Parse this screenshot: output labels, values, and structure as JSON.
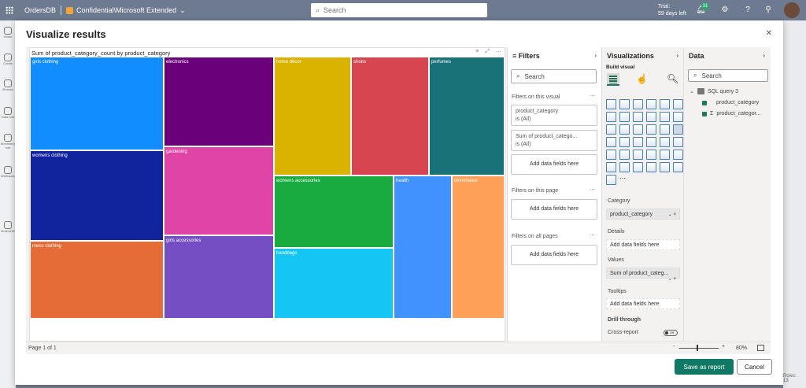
{
  "topbar": {
    "app": "OrdersDB",
    "label": "Confidential\\Microsoft Extended",
    "search_placeholder": "Search",
    "trial_line1": "Trial:",
    "trial_line2": "59 days left",
    "notifications": "31"
  },
  "leftnav": [
    "Home",
    "Create",
    "Browse",
    "Data hub",
    "Monitoring hub",
    "Workspaces",
    "OrdersDB"
  ],
  "background": {
    "rows": "Rows: 13"
  },
  "dialog": {
    "title": "Visualize results",
    "close": "✕"
  },
  "visual": {
    "title": "Sum of product_category_count by product_category",
    "chart_type": "treemap",
    "tiles": [
      {
        "label": "girls clothing",
        "color": "#118dff"
      },
      {
        "label": "womens clothing",
        "color": "#12239e"
      },
      {
        "label": "mens clothing",
        "color": "#e66c37"
      },
      {
        "label": "electronics",
        "color": "#6b007b"
      },
      {
        "label": "gardening",
        "color": "#e044a7"
      },
      {
        "label": "girls accessories",
        "color": "#744ec2"
      },
      {
        "label": "home décor",
        "color": "#d9b300"
      },
      {
        "label": "shoes",
        "color": "#d64550"
      },
      {
        "label": "perfumes",
        "color": "#197278"
      },
      {
        "label": "womens accessories",
        "color": "#1aab40"
      },
      {
        "label": "handbags",
        "color": "#15c6f4"
      },
      {
        "label": "health",
        "color": "#4092ff"
      },
      {
        "label": "dinnerware",
        "color": "#ffa058"
      }
    ]
  },
  "filters": {
    "title": "Filters",
    "search": "Search",
    "on_visual": "Filters on this visual",
    "card1_name": "product_category",
    "card1_val": "is (All)",
    "card2_name": "Sum of product_catego...",
    "card2_val": "is (All)",
    "add": "Add data fields here",
    "on_page": "Filters on this page",
    "on_all": "Filters on all pages"
  },
  "viz": {
    "title": "Visualizations",
    "build": "Build visual",
    "category": "Category",
    "category_field": "product_category",
    "details": "Details",
    "values": "Values",
    "values_field": "Sum of product_categ...",
    "tooltips": "Tooltips",
    "add": "Add data fields here",
    "drill": "Drill through",
    "cross": "Cross-report",
    "toggle": "Off"
  },
  "data": {
    "title": "Data",
    "search": "Search",
    "query": "SQL query 3",
    "field1": "product_category",
    "field2": "product_categor..."
  },
  "footer": {
    "page": "Page 1 of 1",
    "zoom": "80%"
  },
  "buttons": {
    "save": "Save as report",
    "cancel": "Cancel"
  }
}
